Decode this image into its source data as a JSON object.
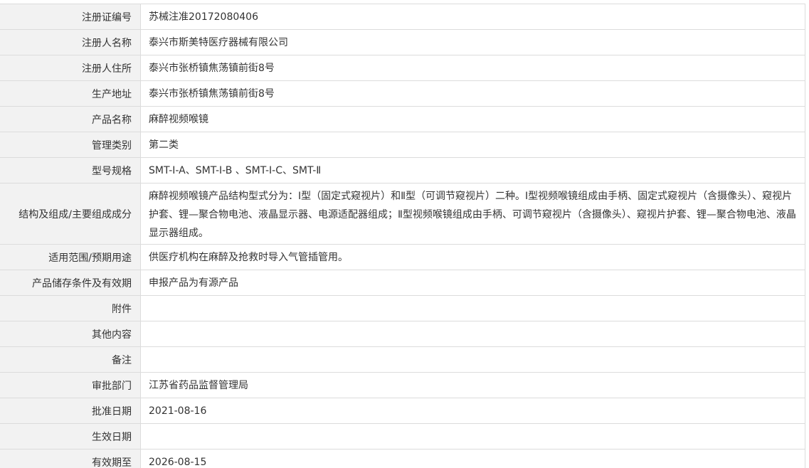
{
  "rows": [
    {
      "label": "注册证编号",
      "value": "苏械注准20172080406"
    },
    {
      "label": "注册人名称",
      "value": "泰兴市斯美特医疗器械有限公司"
    },
    {
      "label": "注册人住所",
      "value": "泰兴市张桥镇焦荡镇前街8号"
    },
    {
      "label": "生产地址",
      "value": "泰兴市张桥镇焦荡镇前街8号"
    },
    {
      "label": "产品名称",
      "value": "麻醉视频喉镜"
    },
    {
      "label": "管理类别",
      "value": "第二类"
    },
    {
      "label": "型号规格",
      "value": "SMT-Ⅰ-A、SMT-Ⅰ-B 、SMT-Ⅰ-C、SMT-Ⅱ"
    },
    {
      "label": "结构及组成/主要组成成分",
      "value": "麻醉视频喉镜产品结构型式分为：Ⅰ型（固定式窥视片）和Ⅱ型（可调节窥视片）二种。Ⅰ型视频喉镜组成由手柄、固定式窥视片（含摄像头）、窥视片护套、锂—聚合物电池、液晶显示器、电源适配器组成；Ⅱ型视频喉镜组成由手柄、可调节窥视片（含摄像头）、窥视片护套、锂—聚合物电池、液晶显示器组成。"
    },
    {
      "label": "适用范围/预期用途",
      "value": "供医疗机构在麻醉及抢救时导入气管插管用。"
    },
    {
      "label": "产品储存条件及有效期",
      "value": "申报产品为有源产品"
    },
    {
      "label": "附件",
      "value": ""
    },
    {
      "label": "其他内容",
      "value": ""
    },
    {
      "label": "备注",
      "value": ""
    },
    {
      "label": "审批部门",
      "value": "江苏省药品监督管理局"
    },
    {
      "label": "批准日期",
      "value": "2021-08-16"
    },
    {
      "label": "生效日期",
      "value": ""
    },
    {
      "label": "有效期至",
      "value": "2026-08-15"
    }
  ]
}
